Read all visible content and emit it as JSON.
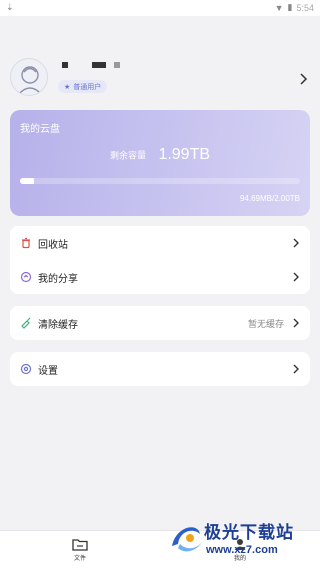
{
  "status_bar": {
    "time": "5:54"
  },
  "profile": {
    "badge": "普通用户",
    "avatar_icon": "avatar-icon"
  },
  "cloud": {
    "title": "我的云盘",
    "remaining_label": "剩余容量",
    "remaining_value": "1.99TB",
    "usage_text": "94.69MB/2.00TB",
    "usage_fraction": 0.05
  },
  "menu": {
    "recycle": {
      "label": "回收站",
      "icon": "trash-icon"
    },
    "share": {
      "label": "我的分享",
      "icon": "share-icon"
    },
    "clear_cache": {
      "label": "清除缓存",
      "sub": "暂无缓存",
      "icon": "broom-icon"
    },
    "settings": {
      "label": "设置",
      "icon": "gear-icon"
    }
  },
  "bottom_nav": {
    "files": "文件",
    "me": "我的"
  },
  "watermark": {
    "name": "极光下载站",
    "url": "www.xz7.com"
  },
  "colors": {
    "card_gradient_start": "#b6b2ea",
    "card_gradient_end": "#d6d3f4",
    "trash": "#e0504a",
    "share": "#8a6ad8",
    "broom": "#3fb27f",
    "gear": "#6e74c8"
  }
}
